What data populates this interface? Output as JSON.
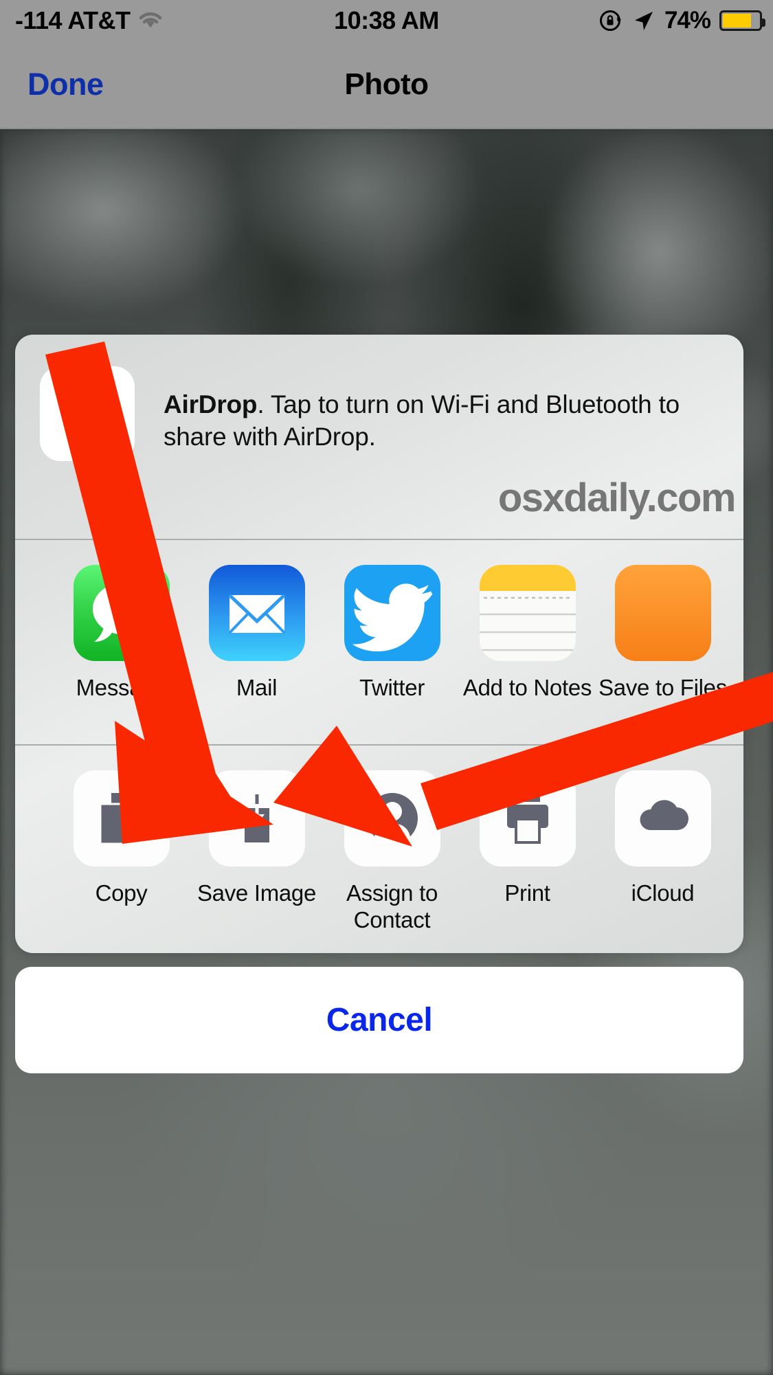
{
  "status_bar": {
    "carrier": "-114 AT&T",
    "wifi_icon": "wifi-icon",
    "time": "10:38 AM",
    "rotation_lock_icon": "rotation-lock-icon",
    "location_icon": "location-arrow-icon",
    "battery_percent": "74%",
    "battery_level": 74,
    "battery_color": "#FFCC00"
  },
  "nav_bar": {
    "done_label": "Done",
    "title": "Photo",
    "done_color": "#0f2fa8"
  },
  "share_sheet": {
    "airdrop": {
      "icon_name": "airdrop-icon",
      "title": "AirDrop",
      "text": ". Tap to turn on Wi-Fi and Bluetooth to share with AirDrop."
    },
    "watermark": "osxdaily.com",
    "app_row": [
      {
        "label": "Message",
        "icon": "messages-app-icon"
      },
      {
        "label": "Mail",
        "icon": "mail-app-icon"
      },
      {
        "label": "Twitter",
        "icon": "twitter-app-icon"
      },
      {
        "label": "Add to Notes",
        "icon": "notes-app-icon"
      },
      {
        "label": "Save to Files",
        "icon": "files-app-icon"
      }
    ],
    "action_row": [
      {
        "label": "Copy",
        "icon": "copy-icon"
      },
      {
        "label": "Save Image",
        "icon": "save-image-icon"
      },
      {
        "label": "Assign to Contact",
        "icon": "assign-contact-icon"
      },
      {
        "label": "Print",
        "icon": "printer-icon"
      },
      {
        "label": "iCloud",
        "icon": "icloud-icon"
      }
    ]
  },
  "cancel_button": {
    "label": "Cancel",
    "color": "#0a26e8"
  },
  "annotations": {
    "arrow_color": "#FA2800",
    "arrows": [
      {
        "name": "arrow-to-save-image-long",
        "target": "Save Image"
      },
      {
        "name": "arrow-to-assign-to-contact",
        "target": "Assign to Contact"
      }
    ]
  }
}
